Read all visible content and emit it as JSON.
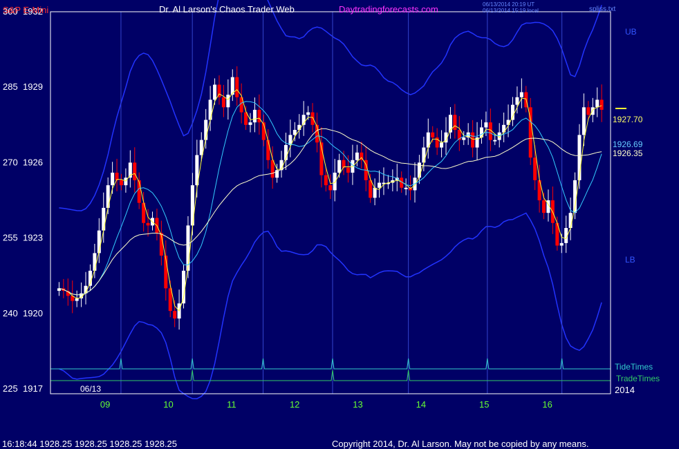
{
  "header": {
    "symbol": "S&P E-Mini",
    "site_title": "Dr. Al Larson's Chaos Trader Web",
    "site_url": "Daytradingforecasts.com",
    "timestamp_ut": "06/13/2014 20:19 UT",
    "timestamp_local": "06/13/2014 15:19 local",
    "file_name": "spliss.txt"
  },
  "footer": {
    "quote": "16:18:44  1928.25 1928.25 1928.25 1928.25",
    "copyright": "Copyright 2014, Dr. Al Larson. May not be copied by any means."
  },
  "chart_data": {
    "type": "candlestick",
    "left_axis_ticks": [
      {
        "value": 1932,
        "label": "1932",
        "osc": "300"
      },
      {
        "value": 1929,
        "label": "1929",
        "osc": "285"
      },
      {
        "value": 1926,
        "label": "1926",
        "osc": "270"
      },
      {
        "value": 1923,
        "label": "1923",
        "osc": "255"
      },
      {
        "value": 1920,
        "label": "1920",
        "osc": "240"
      },
      {
        "value": 1917,
        "label": "1917",
        "osc": "225"
      }
    ],
    "ylim": [
      1917,
      1932
    ],
    "xlim_hours": [
      0,
      88
    ],
    "x_tick_labels": [
      {
        "label": "09",
        "hour": 8
      },
      {
        "label": "10",
        "hour": 18
      },
      {
        "label": "11",
        "hour": 28
      },
      {
        "label": "12",
        "hour": 38
      },
      {
        "label": "13",
        "hour": 48
      },
      {
        "label": "14",
        "hour": 58
      },
      {
        "label": "15",
        "hour": 68
      },
      {
        "label": "16",
        "hour": 78
      }
    ],
    "date_label": "06/13",
    "year_label": "2014",
    "band_labels": {
      "upper": "UB",
      "lower": "LB"
    },
    "price_labels": [
      {
        "value": 1927.7,
        "text": "1927.70",
        "color": "#ffff66"
      },
      {
        "value": 1926.69,
        "text": "1926.69",
        "color": "#66ccff"
      },
      {
        "value": 1926.35,
        "text": "1926.35",
        "color": "#ffffcc"
      }
    ],
    "tide_times": {
      "label": "TideTimes",
      "color": "#33cccc",
      "hours": [
        10.5,
        21.8,
        33.0,
        44.0,
        56.0,
        68.5,
        80.3
      ]
    },
    "trade_times": {
      "label": "TradeTimes",
      "color": "#33cc66",
      "hours": [
        21.8,
        44.0,
        56.0
      ]
    },
    "colors": {
      "background": "#000066",
      "up_bar": "#ffffff",
      "down_bar": "#ff0000",
      "band": "#2233ff",
      "vertical_lines": "#3344cc",
      "axis_text": "#ffffff",
      "date_axis_text": "#66ff33"
    },
    "closes": [
      1921.0,
      1920.9,
      1920.7,
      1920.5,
      1920.6,
      1920.8,
      1921.1,
      1921.7,
      1922.4,
      1923.3,
      1924.2,
      1925.1,
      1925.6,
      1925.3,
      1925.1,
      1925.4,
      1926.0,
      1925.3,
      1924.4,
      1923.6,
      1923.5,
      1923.8,
      1923.2,
      1922.3,
      1921.0,
      1920.1,
      1919.8,
      1920.4,
      1921.7,
      1923.5,
      1925.1,
      1926.3,
      1926.9,
      1927.7,
      1928.5,
      1929.1,
      1928.6,
      1928.2,
      1928.7,
      1929.4,
      1928.6,
      1928.0,
      1927.5,
      1927.6,
      1928.1,
      1927.6,
      1926.9,
      1926.1,
      1925.4,
      1925.7,
      1926.1,
      1926.7,
      1927.1,
      1927.3,
      1927.5,
      1927.9,
      1928.0,
      1927.5,
      1926.8,
      1925.5,
      1925.1,
      1924.9,
      1925.6,
      1926.1,
      1925.8,
      1925.6,
      1926.1,
      1926.4,
      1926.1,
      1925.3,
      1924.6,
      1925.0,
      1925.2,
      1925.2,
      1925.2,
      1925.3,
      1925.4,
      1925.0,
      1925.0,
      1924.9,
      1925.4,
      1926.0,
      1926.6,
      1927.2,
      1927.0,
      1926.6,
      1926.8,
      1927.2,
      1927.9,
      1927.3,
      1926.9,
      1927.0,
      1927.2,
      1926.6,
      1927.0,
      1927.4,
      1927.6,
      1926.9,
      1926.9,
      1927.2,
      1927.5,
      1927.7,
      1928.3,
      1928.6,
      1928.8,
      1928.2,
      1926.2,
      1925.3,
      1924.5,
      1924.0,
      1924.5,
      1923.6,
      1922.7,
      1922.8,
      1923.4,
      1924.0,
      1925.3,
      1927.1,
      1928.2,
      1927.9,
      1928.2,
      1928.5,
      1928.1
    ]
  }
}
